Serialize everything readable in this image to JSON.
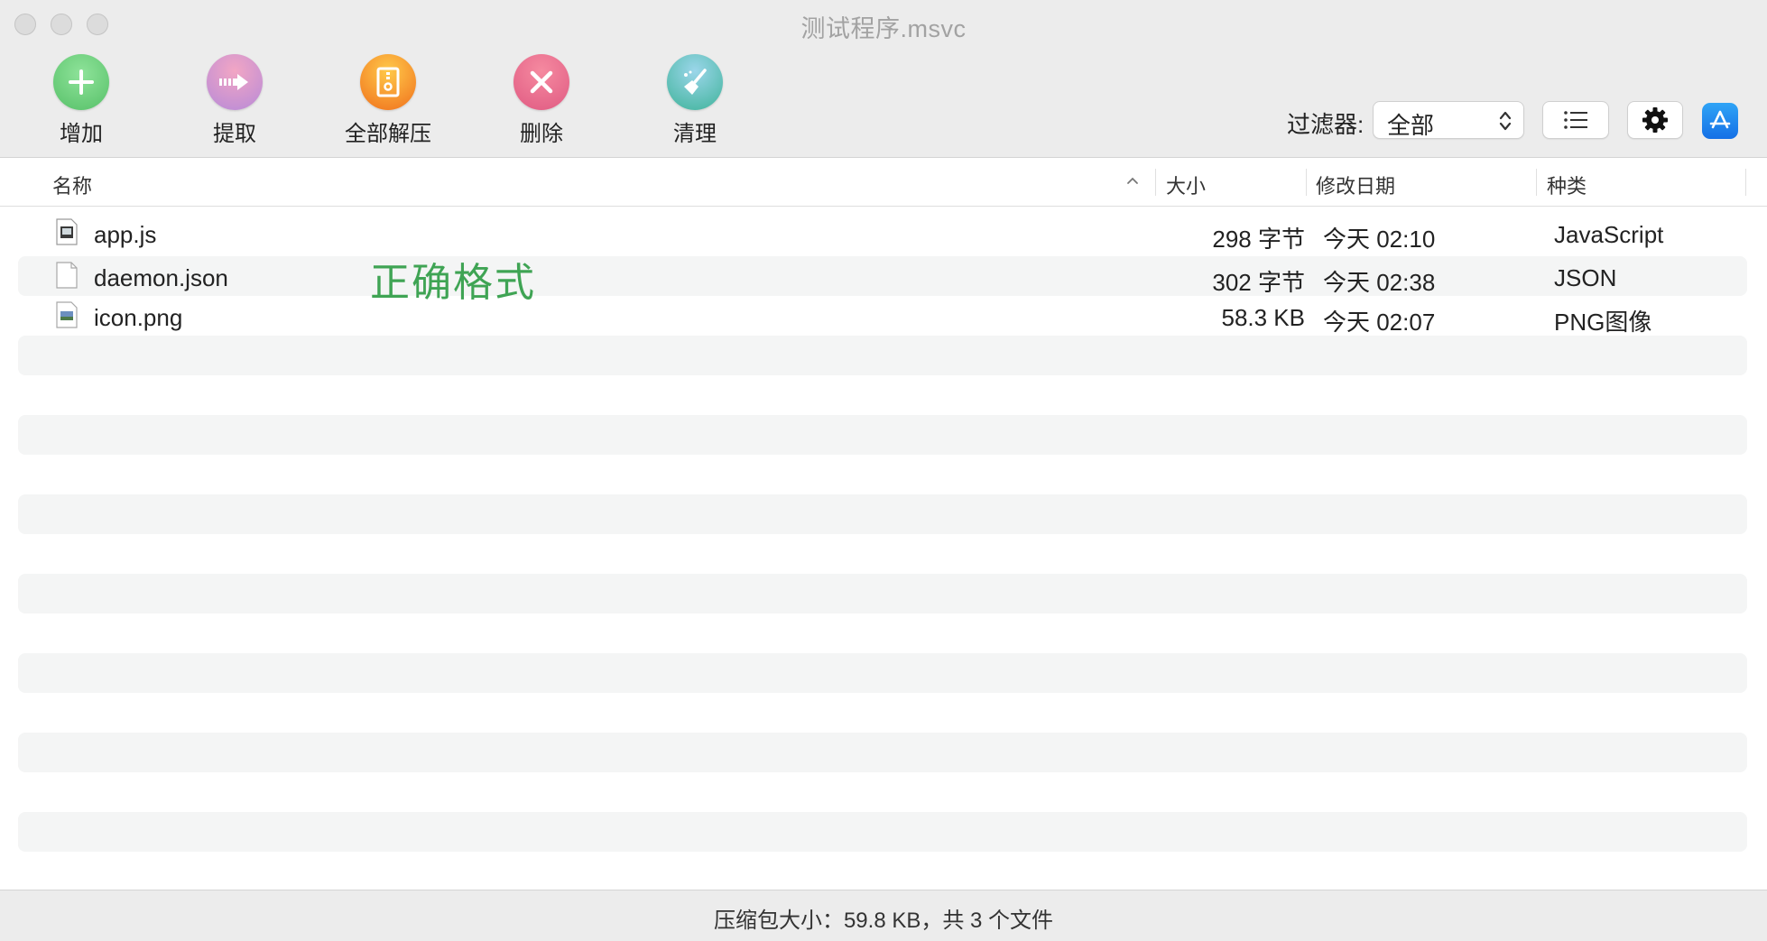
{
  "window": {
    "title": "测试程序.msvc"
  },
  "toolbar": {
    "buttons": [
      {
        "label": "增加",
        "icon": "plus-icon",
        "color": "#5cc46c"
      },
      {
        "label": "提取",
        "icon": "extract-arrow-icon",
        "color": "#c87fd2"
      },
      {
        "label": "全部解压",
        "icon": "zip-icon",
        "color": "#f29a1f"
      },
      {
        "label": "删除",
        "icon": "close-icon",
        "color": "#e4577a"
      },
      {
        "label": "清理",
        "icon": "broom-icon",
        "color": "#4fb3a0"
      }
    ],
    "filter_label": "过滤器:",
    "filter_value": "全部"
  },
  "columns": {
    "name": "名称",
    "size": "大小",
    "date": "修改日期",
    "kind": "种类"
  },
  "files": [
    {
      "name": "app.js",
      "size": "298 字节",
      "date": "今天 02:10",
      "kind": "JavaScript",
      "icon": "script-file-icon"
    },
    {
      "name": "daemon.json",
      "size": "302 字节",
      "date": "今天 02:38",
      "kind": "JSON",
      "icon": "blank-file-icon"
    },
    {
      "name": "icon.png",
      "size": "58.3 KB",
      "date": "今天 02:07",
      "kind": "PNG图像",
      "icon": "image-file-icon"
    }
  ],
  "overlay": "正确格式",
  "status": "压缩包大小：59.8 KB，共 3 个文件"
}
